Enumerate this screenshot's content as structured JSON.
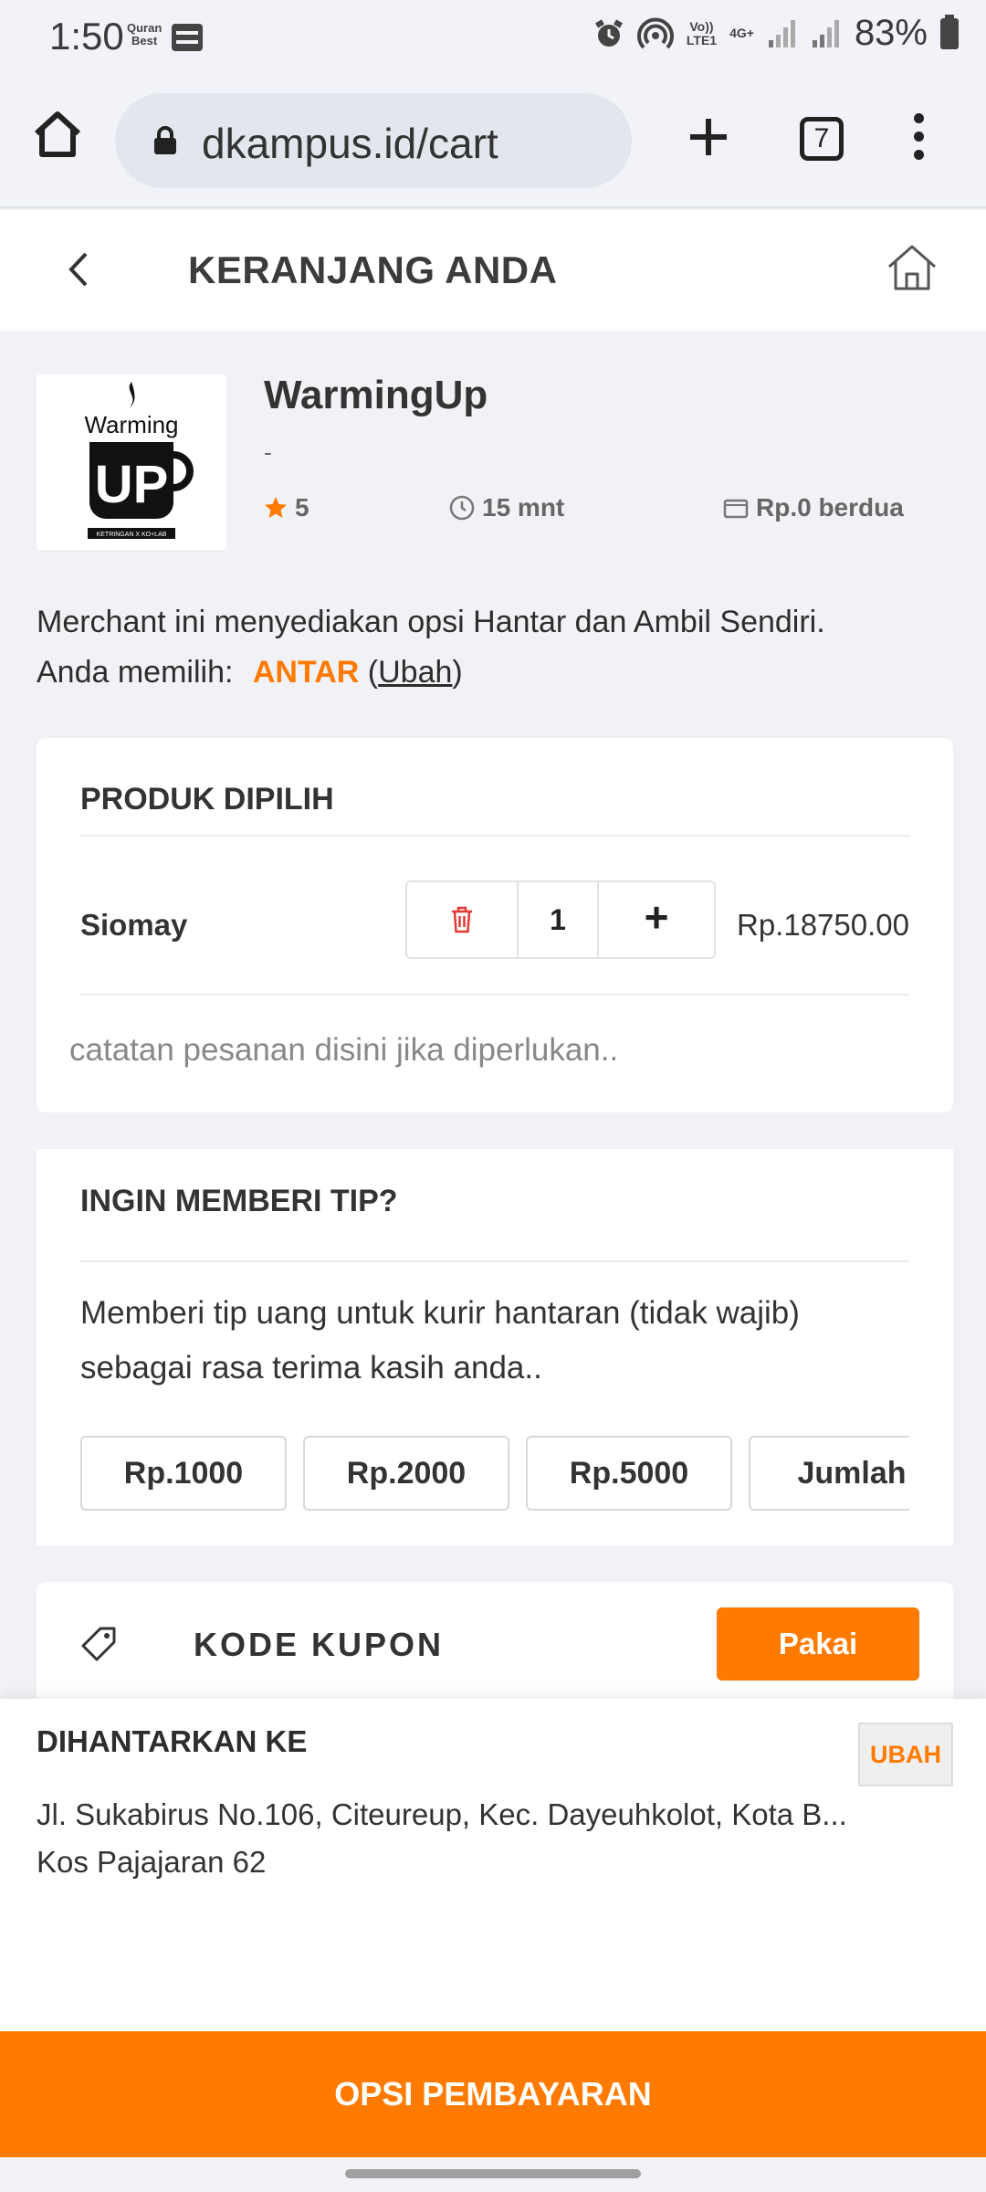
{
  "status_bar": {
    "time": "1:50",
    "quran_app": "Quran Best",
    "volte": "Vo)) LTE1",
    "network": "4G+",
    "battery": "83%"
  },
  "browser": {
    "url": "dkampus.id/cart",
    "tab_count": "7"
  },
  "header": {
    "title": "KERANJANG ANDA"
  },
  "merchant": {
    "logo_text_top": "Warming",
    "logo_text_main": "UP",
    "logo_subtext": "KETRINGAN X KO+LAB",
    "name": "WarmingUp",
    "subtitle": "-",
    "rating": "5",
    "time": "15 mnt",
    "fee": "Rp.0 berdua",
    "info_line1": "Merchant ini menyediakan opsi Hantar dan Ambil Sendiri.",
    "info_line2_prefix": "Anda memilih:",
    "selected_option": "ANTAR",
    "change_link": "Ubah"
  },
  "products": {
    "title": "PRODUK DIPILIH",
    "items": [
      {
        "name": "Siomay",
        "qty": "1",
        "price": "Rp.18750.00",
        "plus_label": "+"
      }
    ],
    "note_placeholder": "catatan pesanan disini jika diperlukan.."
  },
  "tip": {
    "title": "INGIN MEMBERI TIP?",
    "description": "Memberi tip uang untuk kurir hantaran (tidak wajib) sebagai rasa terima kasih anda..",
    "options": [
      "Rp.1000",
      "Rp.2000",
      "Rp.5000",
      "Jumlah"
    ]
  },
  "coupon": {
    "title": "KODE KUPON",
    "apply_label": "Pakai"
  },
  "delivery": {
    "title": "DIHANTARKAN KE",
    "change_label": "UBAH",
    "address": "Jl. Sukabirus No.106, Citeureup, Kec. Dayeuhkolot, Kota B...",
    "note": "Kos Pajajaran 62"
  },
  "payment": {
    "label": "OPSI PEMBAYARAN"
  },
  "colors": {
    "accent": "#ff7a00",
    "background": "#f1f2f5"
  }
}
